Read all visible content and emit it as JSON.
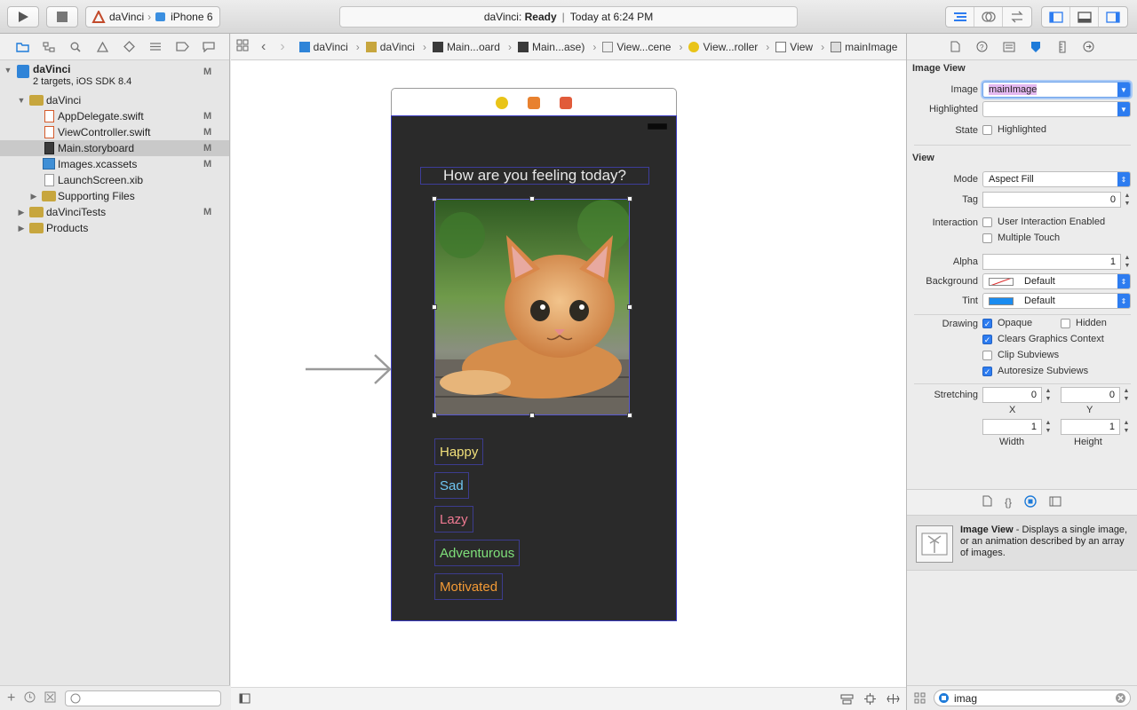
{
  "toolbar": {
    "scheme_target": "daVinci",
    "scheme_device": "iPhone 6",
    "status_app": "daVinci:",
    "status_state": "Ready",
    "status_divider": "|",
    "status_time": "Today at 6:24 PM"
  },
  "navigator": {
    "items": [
      {
        "label": "daVinci",
        "sub": "2 targets, iOS SDK 8.4",
        "badge": "M"
      },
      {
        "label": "daVinci"
      },
      {
        "label": "AppDelegate.swift",
        "badge": "M"
      },
      {
        "label": "ViewController.swift",
        "badge": "M"
      },
      {
        "label": "Main.storyboard",
        "badge": "M"
      },
      {
        "label": "Images.xcassets",
        "badge": "M"
      },
      {
        "label": "LaunchScreen.xib"
      },
      {
        "label": "Supporting Files"
      },
      {
        "label": "daVinciTests",
        "badge": "M"
      },
      {
        "label": "Products"
      }
    ]
  },
  "jumpbar": [
    "daVinci",
    "daVinci",
    "Main...oard",
    "Main...ase)",
    "View...cene",
    "View...roller",
    "View",
    "mainImage"
  ],
  "scene": {
    "question": "How are you feeling today?",
    "buttons": [
      {
        "label": "Happy",
        "color": "#f1e07a"
      },
      {
        "label": "Sad",
        "color": "#6fc6f2"
      },
      {
        "label": "Lazy",
        "color": "#f07a92"
      },
      {
        "label": "Adventurous",
        "color": "#7fe07a"
      },
      {
        "label": "Motivated",
        "color": "#f39a35"
      }
    ]
  },
  "inspector": {
    "image_view_title": "Image View",
    "image_label": "Image",
    "image_value": "mainImage",
    "highlighted_label": "Highlighted",
    "state_label": "State",
    "state_checkbox": "Highlighted",
    "view_title": "View",
    "mode_label": "Mode",
    "mode_value": "Aspect Fill",
    "tag_label": "Tag",
    "tag_value": "0",
    "interaction_label": "Interaction",
    "user_interaction": "User Interaction Enabled",
    "multiple_touch": "Multiple Touch",
    "alpha_label": "Alpha",
    "alpha_value": "1",
    "background_label": "Background",
    "background_value": "Default",
    "tint_label": "Tint",
    "tint_value": "Default",
    "drawing_label": "Drawing",
    "opaque": "Opaque",
    "hidden": "Hidden",
    "clears_graphics": "Clears Graphics Context",
    "clip_subviews": "Clip Subviews",
    "autoresize_subviews": "Autoresize Subviews",
    "stretching_label": "Stretching",
    "stretch_x": "0",
    "stretch_y": "0",
    "stretch_w": "1",
    "stretch_h": "1",
    "x_caption": "X",
    "y_caption": "Y",
    "width_caption": "Width",
    "height_caption": "Height"
  },
  "library": {
    "item_title": "Image View",
    "item_desc": " - Displays a single image, or an animation described by an array of images.",
    "search_value": "imag"
  },
  "colors": {
    "accent": "#2d7cf0",
    "scene_bg": "#2a2a2a"
  }
}
